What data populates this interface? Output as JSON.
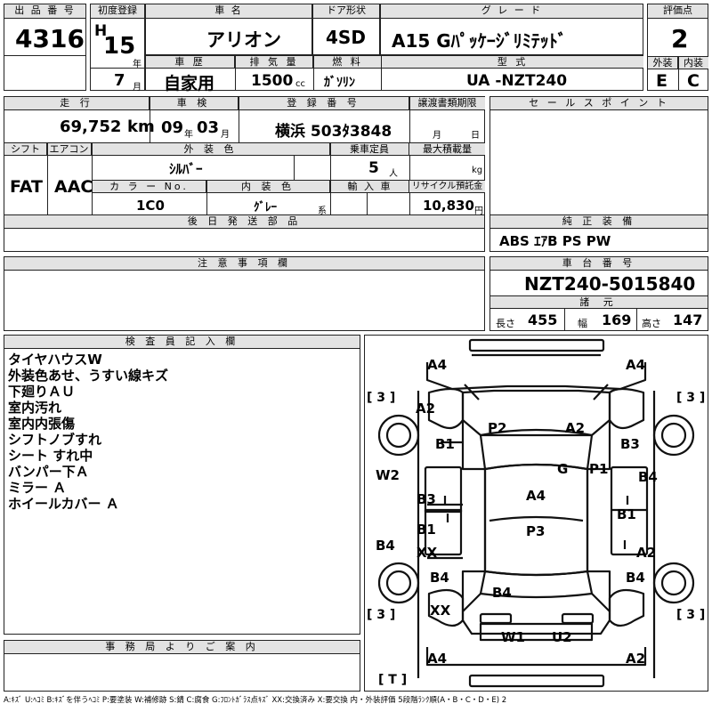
{
  "header": {
    "lot_label": "出 品 番 号",
    "lot_no": "4316",
    "first_reg_label": "初度登録",
    "era": "H",
    "year": "15",
    "year_unit": "年",
    "month": "7",
    "month_unit": "月",
    "car_name_label": "車 名",
    "car_name": "アリオン",
    "door_label": "ドア形状",
    "door": "4SD",
    "grade_label": "グ レ ー ド",
    "grade": "A15 Gﾊﾟｯｹｰｼﾞﾘﾐﾃｯﾄﾞ",
    "score_label": "評価点",
    "score": "2",
    "history_label": "車 歴",
    "history": "自家用",
    "disp_label": "排 気 量",
    "disp": "1500",
    "disp_unit": "cc",
    "fuel_label": "燃 料",
    "fuel": "ｶﾞｿﾘﾝ",
    "model_label": "型 式",
    "model": "UA -NZT240",
    "ext_label": "外装",
    "ext": "E",
    "int_label": "内装",
    "int": "C"
  },
  "info": {
    "mileage_label": "走 行",
    "mileage": "69,752",
    "mileage_unit": "km",
    "inspect_label": "車 検",
    "inspect_y": "09",
    "inspect_y_unit": "年",
    "inspect_m": "03",
    "inspect_m_unit": "月",
    "plate_label": "登 録 番 号",
    "plate": "横浜 503ﾀ3848",
    "transfer_label": "譲渡書類期限",
    "transfer_m": "月",
    "transfer_d": "日",
    "shift_label": "シフト",
    "shift": "FAT",
    "ac_label": "エアコン",
    "ac": "AAC",
    "color_label": "外 装 色",
    "color": "ｼﾙﾊﾞｰ",
    "capacity_label": "乗車定員",
    "capacity": "5",
    "capacity_unit": "人",
    "load_label": "最大積載量",
    "load_unit": "kg",
    "colorno_label": "カ ラ ー No.",
    "colorno": "1C0",
    "intcolor_label": "内 装 色",
    "intcolor": "ｸﾞﾚｰ",
    "intcolor_unit": "系",
    "import_label": "輸 入 車",
    "recycle_label": "リサイクル預託金",
    "recycle": "10,830",
    "recycle_unit": "円",
    "later_label": "後 日 発 送 部 品"
  },
  "right": {
    "sales_label": "セ ー ル ス ポ イ ン ト",
    "equip_label": "純 正 装 備",
    "equip": "ABS ｴｱB PS PW",
    "chassis_label": "車 台 番 号",
    "chassis": "NZT240-5015840",
    "dims_label": "諸 元",
    "len_label": "長さ",
    "len": "455",
    "wid_label": "幅",
    "wid": "169",
    "hei_label": "高さ",
    "hei": "147"
  },
  "notes_label": "注 意 事 項 欄",
  "inspector_label": "検 査 員 記 入 欄",
  "inspector_notes": [
    "タイヤハウスW",
    "外装色あせ、うすい線キズ",
    "下廻りＡＵ",
    "室内汚れ",
    "室内内張傷",
    "シフトノブすれ",
    "シート すれ中",
    "バンパー下Ａ",
    "ミラー Ａ",
    "ホイールカバー Ａ"
  ],
  "office_label": "事 務 局 よ り ご 案 内",
  "diagram": {
    "tire_fl": "[ 3 ]",
    "tire_fr": "[ 3 ]",
    "tire_rl": "[ 3 ]",
    "tire_rr": "[ 3 ]",
    "trunk": "[ T ]",
    "marks": [
      {
        "id": "front-bumper-left",
        "text": "A4"
      },
      {
        "id": "front-bumper-right",
        "text": "A4"
      },
      {
        "id": "left-front-fender",
        "text": "A2"
      },
      {
        "id": "hood-left",
        "text": "P2"
      },
      {
        "id": "hood-right",
        "text": "A2"
      },
      {
        "id": "left-front-fender-lower",
        "text": "B1"
      },
      {
        "id": "right-front-fender",
        "text": "B3"
      },
      {
        "id": "windshield",
        "text": "G"
      },
      {
        "id": "right-pillar",
        "text": "P1"
      },
      {
        "id": "left-side",
        "text": "W2"
      },
      {
        "id": "right-front-door",
        "text": "B4"
      },
      {
        "id": "left-front-door",
        "text": "B3"
      },
      {
        "id": "roof-front",
        "text": "A4"
      },
      {
        "id": "right-rear-door",
        "text": "B1"
      },
      {
        "id": "left-rear-door",
        "text": "B1"
      },
      {
        "id": "roof-rear",
        "text": "P3"
      },
      {
        "id": "left-rocker",
        "text": "B4"
      },
      {
        "id": "left-rear-door-lower",
        "text": "XX"
      },
      {
        "id": "right-rear-quarter",
        "text": "A2"
      },
      {
        "id": "left-rear-quarter",
        "text": "B4"
      },
      {
        "id": "right-rear-fender",
        "text": "B4"
      },
      {
        "id": "trunk-lid",
        "text": "B4"
      },
      {
        "id": "left-rear-lower",
        "text": "XX"
      },
      {
        "id": "rear-left",
        "text": "W1"
      },
      {
        "id": "rear-right",
        "text": "U2"
      },
      {
        "id": "rear-bumper-left",
        "text": "A4"
      },
      {
        "id": "rear-bumper-right",
        "text": "A2"
      }
    ]
  },
  "legend": "A:ｷｽﾞ U:ﾍｺﾐ B:ｷｽﾞを伴うﾍｺﾐ P:要塗装 W:補修跡 S:錆 C:腐食 G:ﾌﾛﾝﾄｶﾞﾗｽ点ｷｽﾞ XX:交換済み X:要交換 内・外装評価 5段階ﾗﾝｸ順(A・B・C・D・E) 2"
}
